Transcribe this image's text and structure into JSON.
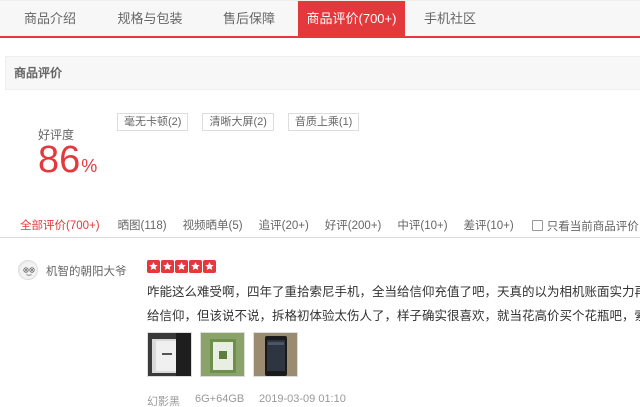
{
  "tabs": [
    {
      "label": "商品介绍"
    },
    {
      "label": "规格与包装"
    },
    {
      "label": "售后保障"
    },
    {
      "label": "商品评价(700+)"
    },
    {
      "label": "手机社区"
    }
  ],
  "section": {
    "title": "商品评价"
  },
  "rating": {
    "label": "好评度",
    "value": "86",
    "unit": "%"
  },
  "tags": [
    {
      "label": "毫无卡顿(2)"
    },
    {
      "label": "清晰大屏(2)"
    },
    {
      "label": "音质上乘(1)"
    }
  ],
  "filters": [
    {
      "label": "全部评价(700+)"
    },
    {
      "label": "晒图(118)"
    },
    {
      "label": "视频晒单(5)"
    },
    {
      "label": "追评(20+)"
    },
    {
      "label": "好评(200+)"
    },
    {
      "label": "中评(10+)"
    },
    {
      "label": "差评(10+)"
    }
  ],
  "only_current": {
    "label": "只看当前商品评价"
  },
  "review": {
    "username": "机智的朝阳大爷",
    "stars": 5,
    "line1": "咋能这么难受啊，四年了重拾索尼手机，全当给信仰充值了吧，天真的以为相机账面实力再弱",
    "line2": "给信仰，但该说不说，拆格初体验太伤人了，样子确实很喜欢，就当花高价买个花瓶吧，索尼",
    "color": "幻影黑",
    "spec": "6G+64GB",
    "date": "2019-03-09 01:10"
  },
  "colors": {
    "accent": "#e4393c",
    "star": "#e4393c"
  }
}
